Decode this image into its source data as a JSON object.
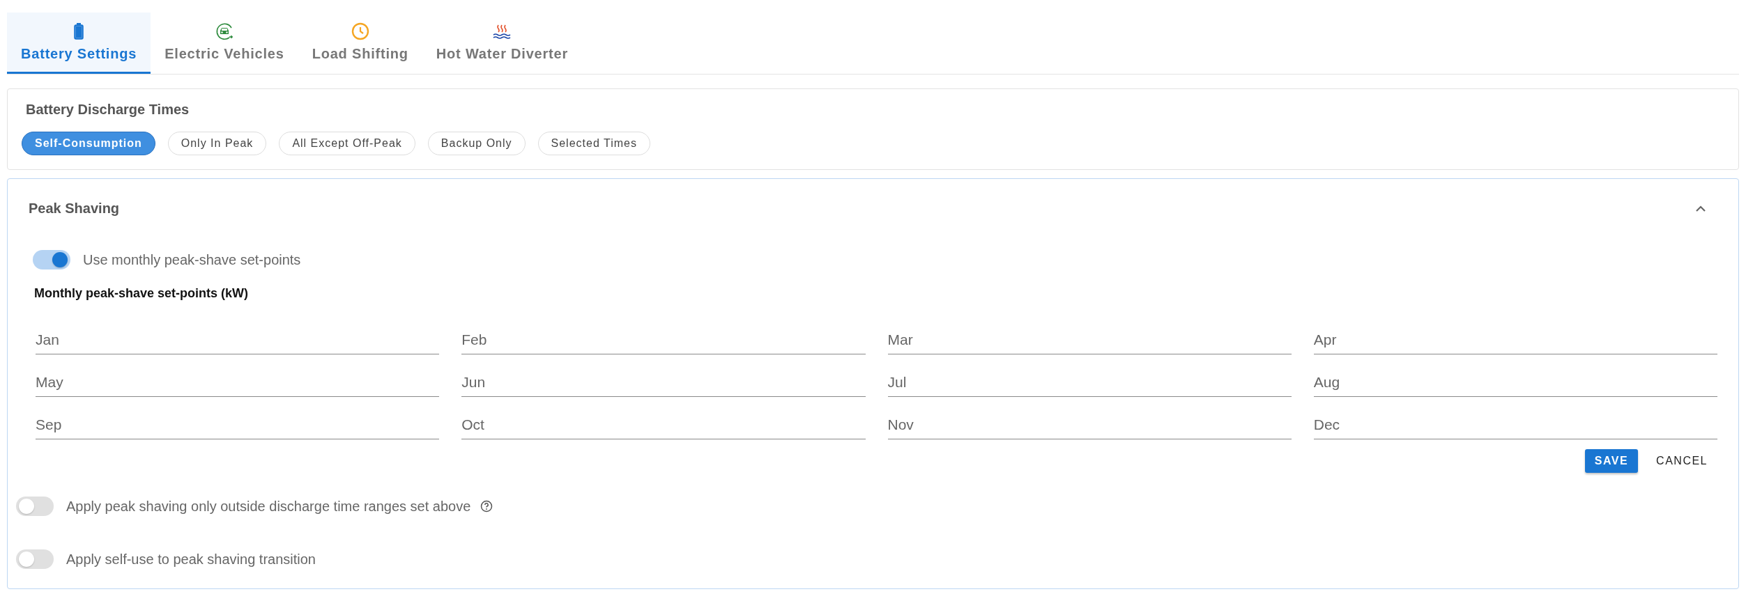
{
  "tabs": [
    {
      "label": "Battery Settings",
      "kind": "battery",
      "selected": true
    },
    {
      "label": "Electric Vehicles",
      "kind": "car",
      "selected": false
    },
    {
      "label": "Load Shifting",
      "kind": "clock",
      "selected": false
    },
    {
      "label": "Hot Water Diverter",
      "kind": "water",
      "selected": false
    }
  ],
  "discharge_times": {
    "title": "Battery Discharge Times",
    "options": [
      {
        "label": "Self-Consumption",
        "selected": true
      },
      {
        "label": "Only In Peak",
        "selected": false
      },
      {
        "label": "All Except Off-Peak",
        "selected": false
      },
      {
        "label": "Backup Only",
        "selected": false
      },
      {
        "label": "Selected Times",
        "selected": false
      }
    ]
  },
  "peak_shaving": {
    "title": "Peak Shaving",
    "expanded": true,
    "monthly_toggle": {
      "label": "Use monthly peak-shave set-points",
      "on": true
    },
    "setpoints_title": "Monthly peak-shave set-points (kW)",
    "months": [
      {
        "placeholder": "Jan"
      },
      {
        "placeholder": "Feb"
      },
      {
        "placeholder": "Mar"
      },
      {
        "placeholder": "Apr"
      },
      {
        "placeholder": "May"
      },
      {
        "placeholder": "Jun"
      },
      {
        "placeholder": "Jul"
      },
      {
        "placeholder": "Aug"
      },
      {
        "placeholder": "Sep"
      },
      {
        "placeholder": "Oct"
      },
      {
        "placeholder": "Nov"
      },
      {
        "placeholder": "Dec"
      }
    ],
    "buttons": [
      {
        "label": "SAVE",
        "kind": "primary"
      },
      {
        "label": "CANCEL",
        "kind": "text"
      }
    ],
    "options": [
      {
        "label": "Apply peak shaving only outside discharge time ranges set above",
        "on": false,
        "help": true
      },
      {
        "label": "Apply self-use to peak shaving transition",
        "on": false,
        "help": false
      }
    ]
  }
}
